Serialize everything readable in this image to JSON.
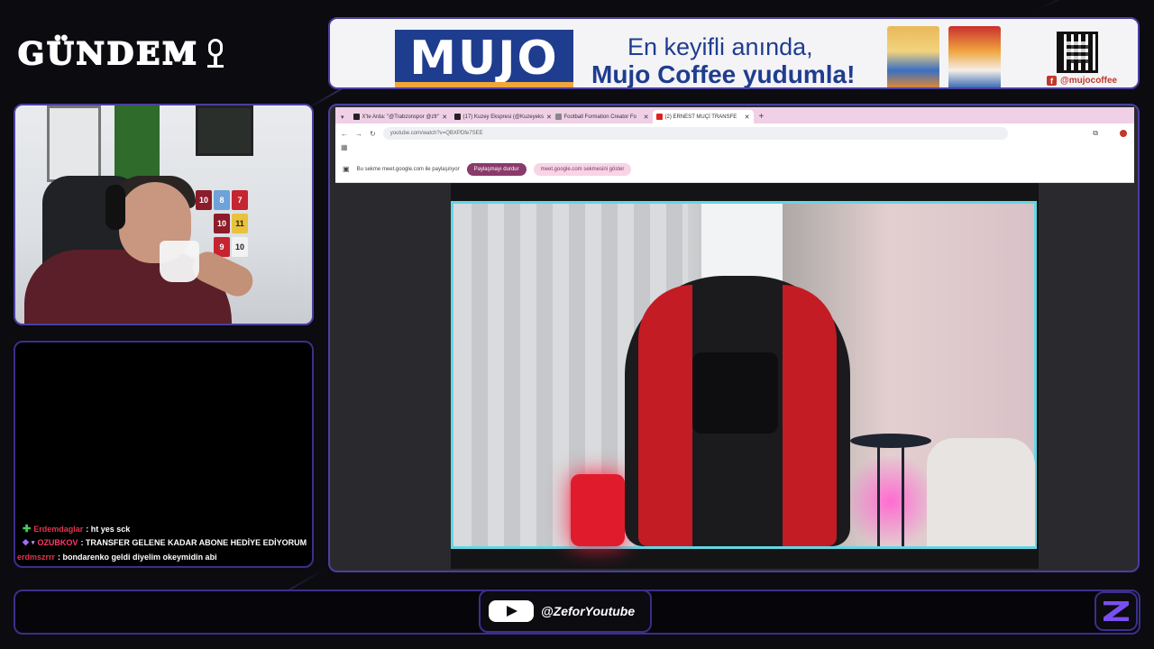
{
  "logo": {
    "text": "GÜNDEM",
    "icon": "microphone-icon"
  },
  "ad": {
    "brand": "MUJO",
    "line1": "En keyifli anında,",
    "line2": "Mujo Coffee yudumla!",
    "handle": "@mujocoffee",
    "social_icon": "facebook-icon"
  },
  "chat": {
    "messages": [
      {
        "user": "Erdemdaglar",
        "text": ": ht yes sck",
        "badge": "plus"
      },
      {
        "user": "OZUBKOV",
        "text": ": TRANSFER GELENE KADAR ABONE HEDİYE EDİYORUM",
        "badge": "gem"
      },
      {
        "user": "erdmszrrr",
        "text": ": bondarenko geldi diyelim okeymidin abi",
        "badge": ""
      }
    ]
  },
  "browser": {
    "tabs": [
      {
        "label": "X'te Arda: \"@Trabzonspor @zfr\"",
        "icon": "x-icon"
      },
      {
        "label": "(17) Kuzey Ekspresi (@Kuzeyeks",
        "icon": "x-icon"
      },
      {
        "label": "Football Formation Creator Fo",
        "icon": "doc-icon"
      },
      {
        "label": "(2) ERNEST MUÇİ TRANSFE",
        "icon": "youtube-icon",
        "active": true
      }
    ],
    "url": "youtube.com/watch?v=QBXPDfe7SEE",
    "share_text": "Bu sekme meet.google.com ile paylaşılıyor",
    "stop_share": "Paylaşmayı durdur",
    "show_tab": "meet.google.com sekmesini göster"
  },
  "footer": {
    "youtube_handle": "@ZeforYoutube"
  },
  "colors": {
    "panel_border": "#3b2f8a",
    "ad_blue": "#1f3d8f",
    "video_border": "#63d6e4",
    "stop_share_bg": "#8a3a6b"
  }
}
